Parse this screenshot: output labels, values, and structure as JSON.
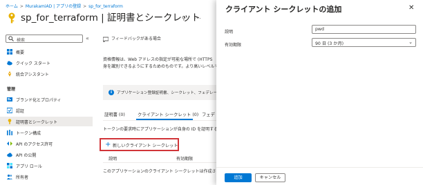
{
  "breadcrumb": [
    "ホーム",
    "MurakamiAD | アプリの登録",
    "sp_for_terraform"
  ],
  "header": {
    "title": "sp_for_terraform | 証明書とシークレット",
    "pin_icon": "pin-icon",
    "more": "..."
  },
  "sidebar": {
    "search_placeholder": "検索",
    "collapse": "«",
    "items_top": [
      {
        "label": "概要",
        "icon": "overview-grid-icon"
      },
      {
        "label": "クイック スタート",
        "icon": "quickstart-cloud-icon"
      },
      {
        "label": "統合アシスタント",
        "icon": "rocket-icon"
      }
    ],
    "section_label": "管理",
    "items_manage": [
      {
        "label": "ブランド化とプロパティ",
        "icon": "branding-icon"
      },
      {
        "label": "認証",
        "icon": "authentication-icon"
      },
      {
        "label": "証明書とシークレット",
        "icon": "key-icon",
        "active": true
      },
      {
        "label": "トークン構成",
        "icon": "token-bars-icon"
      },
      {
        "label": "API のアクセス許可",
        "icon": "api-permissions-icon"
      },
      {
        "label": "API の公開",
        "icon": "expose-api-cloud-icon"
      },
      {
        "label": "アプリ ロール",
        "icon": "app-roles-icon"
      },
      {
        "label": "所有者",
        "icon": "owners-icon"
      }
    ]
  },
  "main": {
    "feedback": "フィードバックがある場合",
    "description_line1": "資格情報は、Web アドレスの指定が可能な場所で (HTTPS",
    "description_line2": "身を識別できるようにするためのものです。より高いレベルで",
    "info_text": "アプリケーション登録証明書、シークレット、フェデレーション",
    "tabs": [
      {
        "label": "証明書 (0)"
      },
      {
        "label": "クライアント シークレット (0)",
        "active": true
      },
      {
        "label": "フェデ"
      }
    ],
    "subtext": "トークンの要求時にアプリケーションが自身の ID を証明する",
    "new_secret_button": "新しいクライアント シークレット",
    "table_headers": [
      "説明",
      "有効期限"
    ],
    "empty_text": "このアプリケーションのクライアント シークレットは作成されて"
  },
  "panel": {
    "title": "クライアント シークレットの追加",
    "close": "✕",
    "description_label": "説明",
    "description_value": "pwd",
    "expiry_label": "有効期限",
    "expiry_value": "90 日 (3 か月)",
    "add_button": "追加",
    "cancel_button": "キャンセル"
  },
  "colors": {
    "accent": "#0078d4",
    "highlight_border": "#d13438",
    "key": "#e8b100"
  }
}
